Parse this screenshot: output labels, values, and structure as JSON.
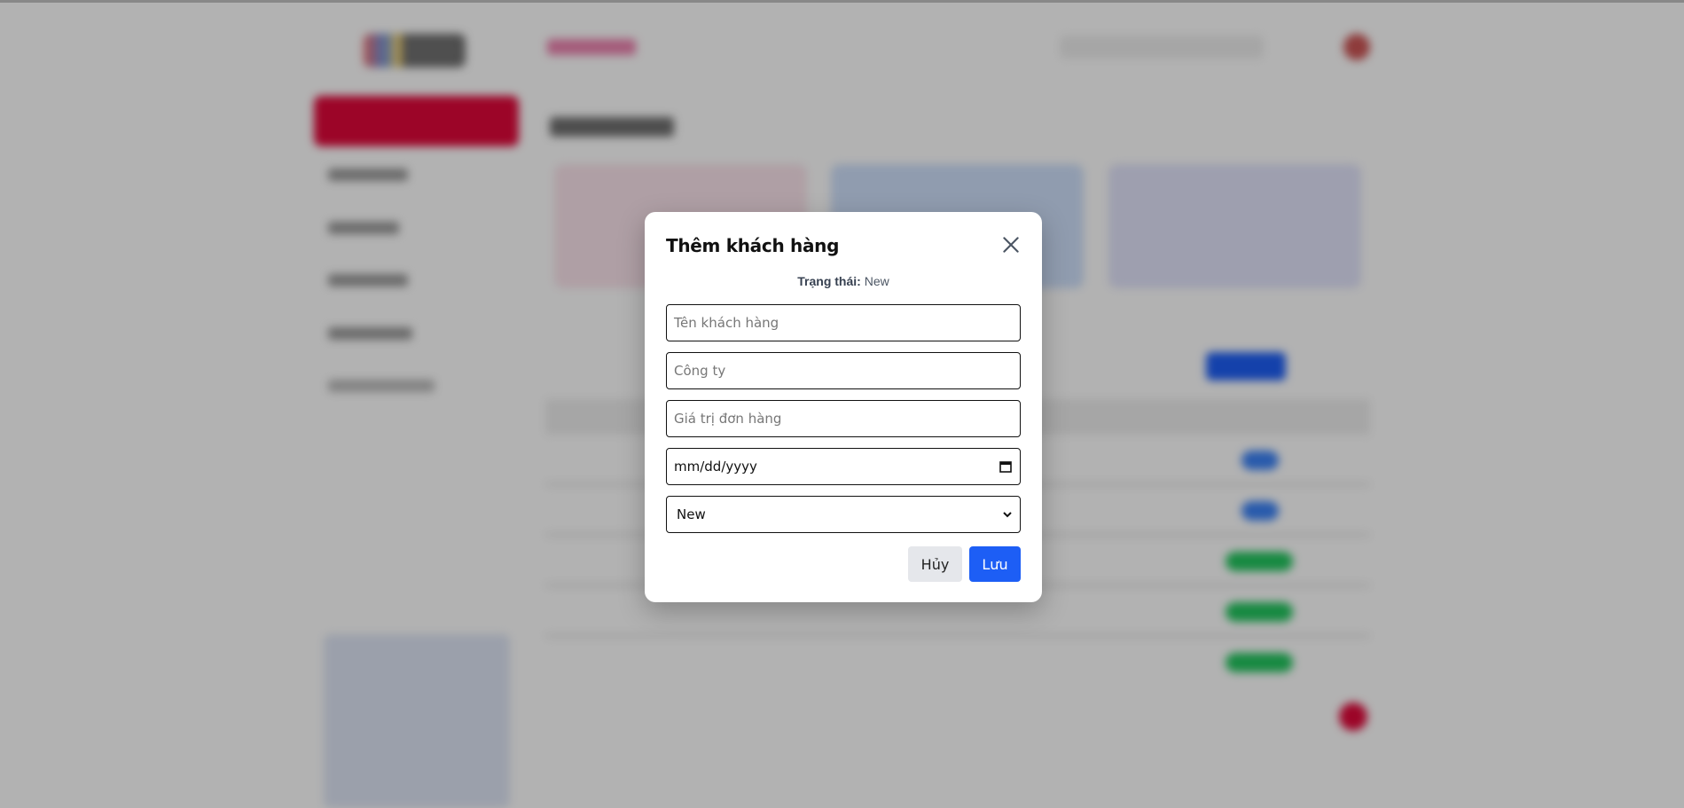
{
  "modal": {
    "title": "Thêm khách hàng",
    "status_label": "Trạng thái:",
    "status_value": "New",
    "fields": {
      "name_placeholder": "Tên khách hàng",
      "company_placeholder": "Công ty",
      "order_value_placeholder": "Giá trị đơn hàng",
      "date_placeholder": "mm/dd/yyyy",
      "status_selected": "New"
    },
    "cancel_label": "Hủy",
    "save_label": "Lưu"
  },
  "colors": {
    "accent": "#e0083a",
    "primary": "#1d5ef5",
    "cancel_bg": "#e5e7eb"
  }
}
